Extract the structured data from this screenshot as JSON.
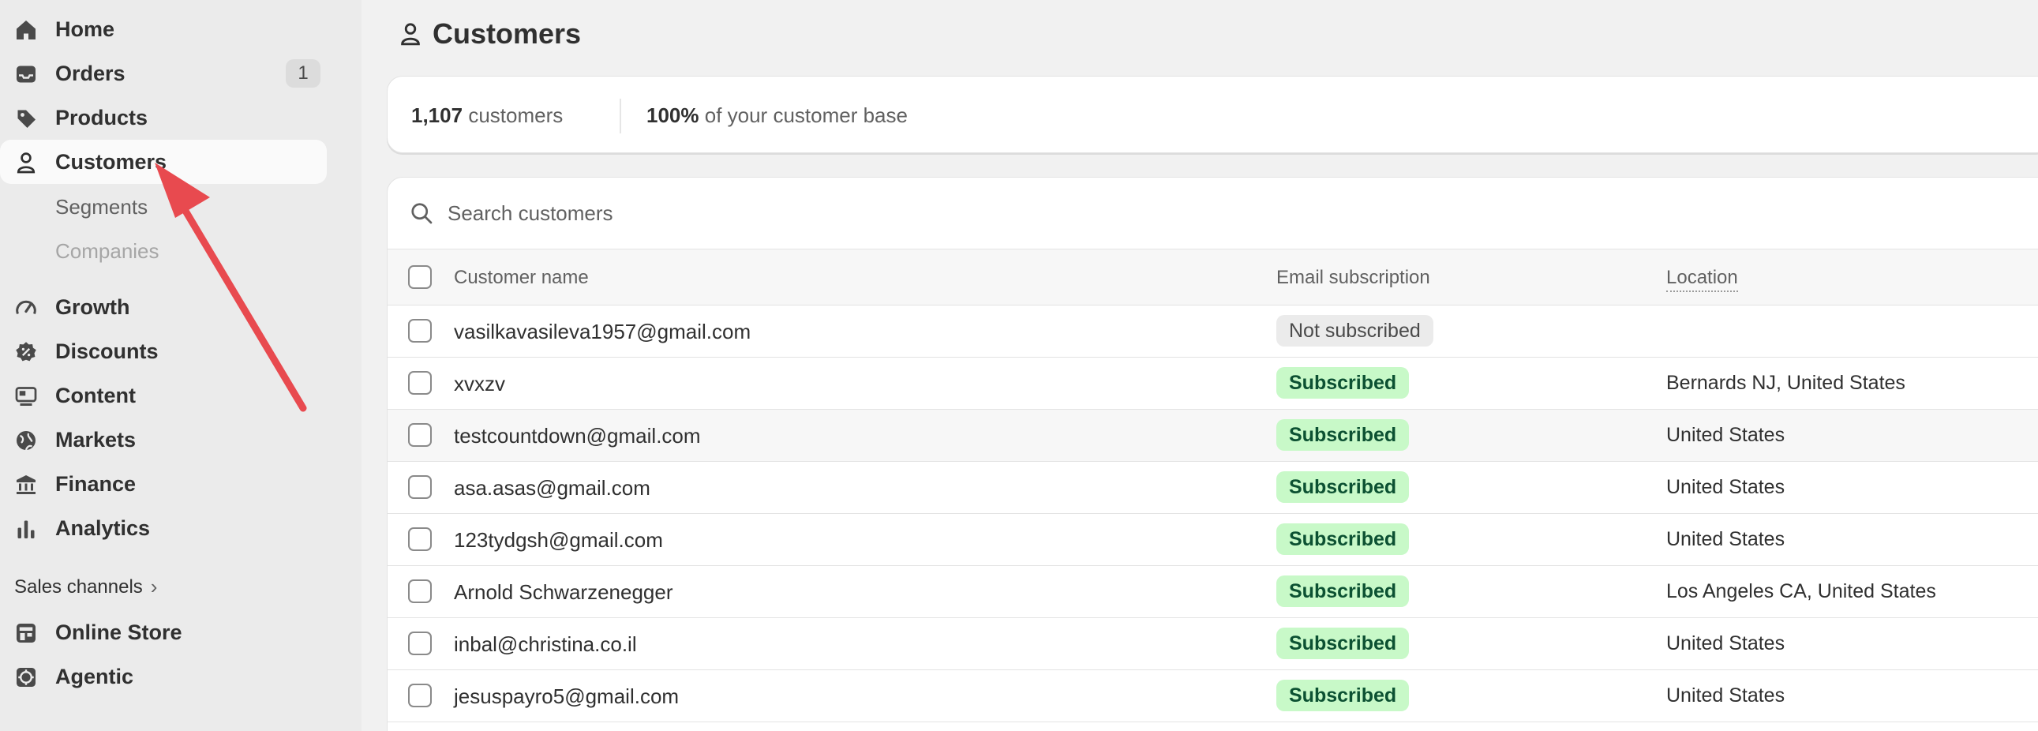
{
  "sidebar": {
    "items": [
      {
        "label": "Home",
        "icon": "home-icon"
      },
      {
        "label": "Orders",
        "icon": "inbox-icon",
        "badge": "1"
      },
      {
        "label": "Products",
        "icon": "tag-icon"
      },
      {
        "label": "Customers",
        "icon": "person-icon",
        "active": true
      },
      {
        "label": "Growth",
        "icon": "gauge-icon"
      },
      {
        "label": "Discounts",
        "icon": "discount-icon"
      },
      {
        "label": "Content",
        "icon": "content-icon"
      },
      {
        "label": "Markets",
        "icon": "globe-icon"
      },
      {
        "label": "Finance",
        "icon": "bank-icon"
      },
      {
        "label": "Analytics",
        "icon": "bar-chart-icon"
      }
    ],
    "sub_items": [
      {
        "label": "Segments"
      },
      {
        "label": "Companies"
      }
    ],
    "sales_channels_label": "Sales channels",
    "channels": [
      {
        "label": "Online Store",
        "icon": "store-icon"
      },
      {
        "label": "Agentic",
        "icon": "agentic-icon"
      }
    ]
  },
  "page": {
    "title": "Customers",
    "summary": {
      "count_value": "1,107",
      "count_label": "customers",
      "share_value": "100%",
      "share_label": "of your customer base"
    },
    "search_placeholder": "Search customers",
    "columns": {
      "name": "Customer name",
      "email_subscription": "Email subscription",
      "location": "Location"
    },
    "rows": [
      {
        "name": "vasilkavasileva1957@gmail.com",
        "subscription": "Not subscribed",
        "location": ""
      },
      {
        "name": "xvxzv",
        "subscription": "Subscribed",
        "location": "Bernards NJ, United States"
      },
      {
        "name": "testcountdown@gmail.com",
        "subscription": "Subscribed",
        "location": "United States"
      },
      {
        "name": "asa.asas@gmail.com",
        "subscription": "Subscribed",
        "location": "United States"
      },
      {
        "name": "123tydgsh@gmail.com",
        "subscription": "Subscribed",
        "location": "United States"
      },
      {
        "name": "Arnold Schwarzenegger",
        "subscription": "Subscribed",
        "location": "Los Angeles CA, United States"
      },
      {
        "name": "inbal@christina.co.il",
        "subscription": "Subscribed",
        "location": "United States"
      },
      {
        "name": "jesuspayro5@gmail.com",
        "subscription": "Subscribed",
        "location": "United States"
      }
    ]
  },
  "colors": {
    "arrow": "#e84a4f",
    "subscribed_bg": "#c8f9c8",
    "subscribed_text": "#0c5132"
  }
}
